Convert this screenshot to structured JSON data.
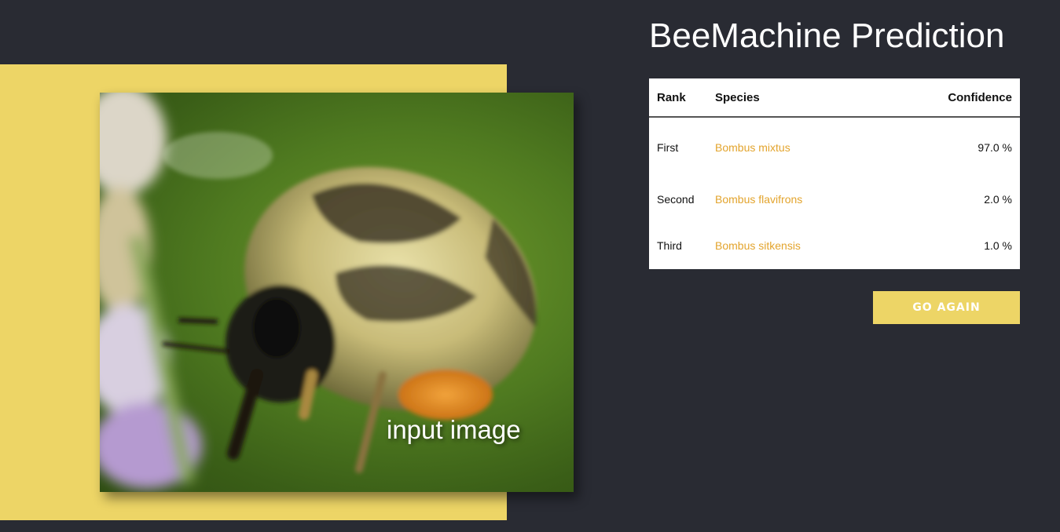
{
  "page": {
    "title": "BeeMachine Prediction"
  },
  "image": {
    "caption": "input image"
  },
  "results": {
    "headers": {
      "rank": "Rank",
      "species": "Species",
      "confidence": "Confidence"
    },
    "rows": [
      {
        "rank": "First",
        "species": "Bombus mixtus",
        "confidence": "97.0 %"
      },
      {
        "rank": "Second",
        "species": "Bombus flavifrons",
        "confidence": "2.0 %"
      },
      {
        "rank": "Third",
        "species": "Bombus sitkensis",
        "confidence": "1.0 %"
      }
    ]
  },
  "actions": {
    "go_again_label": "GO AGAIN"
  },
  "colors": {
    "background": "#292b33",
    "accent_yellow": "#edd566",
    "link_orange": "#e3a42d"
  }
}
